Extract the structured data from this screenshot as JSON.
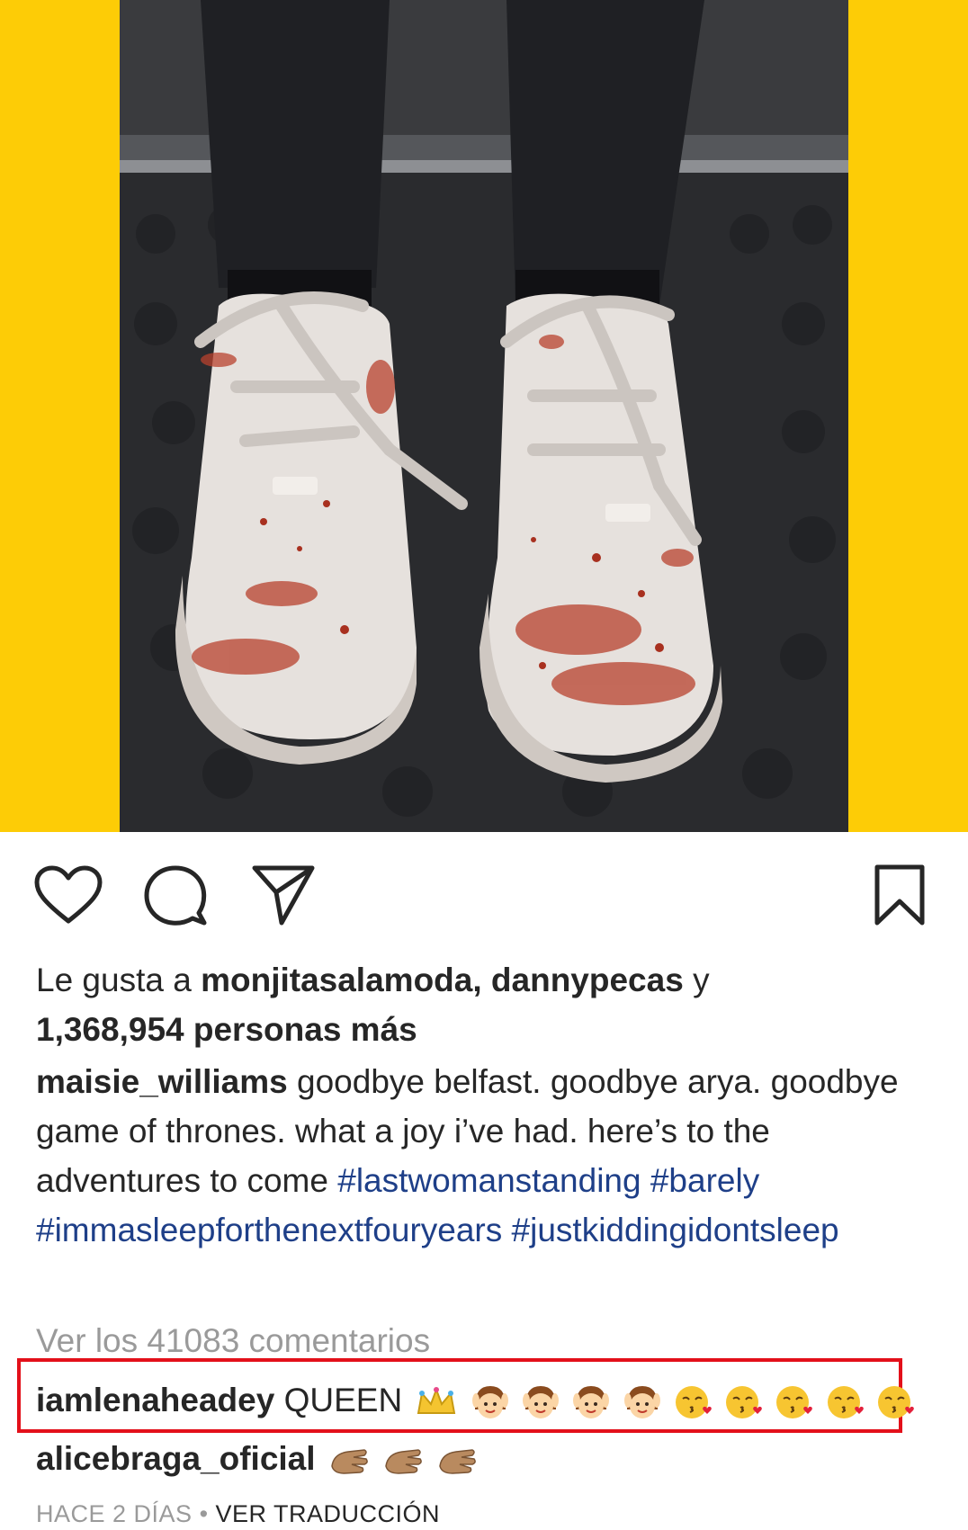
{
  "post": {
    "image_alt": "",
    "colors": {
      "frame": "#fdcc06",
      "hashtag": "#1e3f88",
      "highlight_box": "#e3101a"
    }
  },
  "actions": {
    "like_icon": "heart-icon",
    "comment_icon": "comment-bubble-icon",
    "share_icon": "paper-plane-icon",
    "save_icon": "bookmark-icon"
  },
  "likes": {
    "prefix": "Le gusta a ",
    "user1": "monjitasalamoda",
    "sep": ", ",
    "user2": "dannypecas",
    "conj": " y",
    "count_text": "1,368,954 personas más"
  },
  "caption": {
    "username": "maisie_williams",
    "text": " goodbye belfast. goodbye arya. goodbye game of thrones. what a joy i’ve had. here’s to the adventures to come ",
    "hashtags": [
      "#lastwomanstanding",
      "#barely",
      "#immasleepforthenextfouryears",
      "#justkiddingidontsleep"
    ]
  },
  "view_comments": "Ver los 41083 comentarios",
  "comments": [
    {
      "username": "iamlenaheadey",
      "text": " QUEEN",
      "emojis": [
        "crown",
        "face",
        "face",
        "face",
        "face",
        "kiss",
        "kiss",
        "kiss",
        "kiss",
        "kiss"
      ]
    },
    {
      "username": "alicebraga_oficial",
      "text": "",
      "emojis": [
        "clap",
        "clap",
        "clap"
      ]
    }
  ],
  "footer": {
    "time": "HACE 2 DÍAS",
    "dot": " • ",
    "translate": "VER TRADUCCIÓN"
  }
}
